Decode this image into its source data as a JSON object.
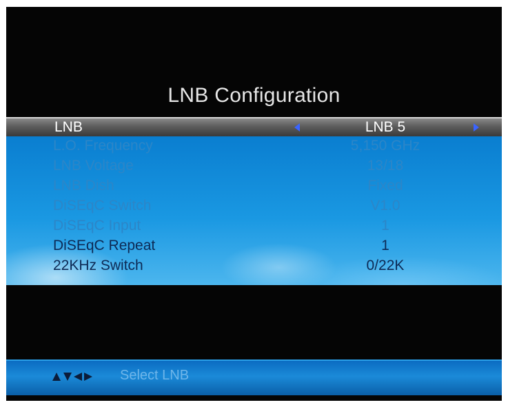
{
  "title": "LNB Configuration",
  "selected": {
    "label": "LNB",
    "value": "LNB 5"
  },
  "rows": [
    {
      "label": "L.O. Frequency",
      "value": "5,150 GHz"
    },
    {
      "label": "LNB Voltage",
      "value": "13/18"
    },
    {
      "label": "LNB Dish",
      "value": "Fixed"
    },
    {
      "label": "DiSEqC Switch",
      "value": "V1.0"
    },
    {
      "label": "DiSEqC Input",
      "value": "1"
    },
    {
      "label": "DiSEqC Repeat",
      "value": "1"
    },
    {
      "label": "22KHz Switch",
      "value": "0/22K"
    }
  ],
  "footer": {
    "hint": "Select LNB"
  },
  "colors": {
    "highlight": "#5c5c5c",
    "panel": "#1a98e2",
    "arrow": "#3a64ff"
  }
}
